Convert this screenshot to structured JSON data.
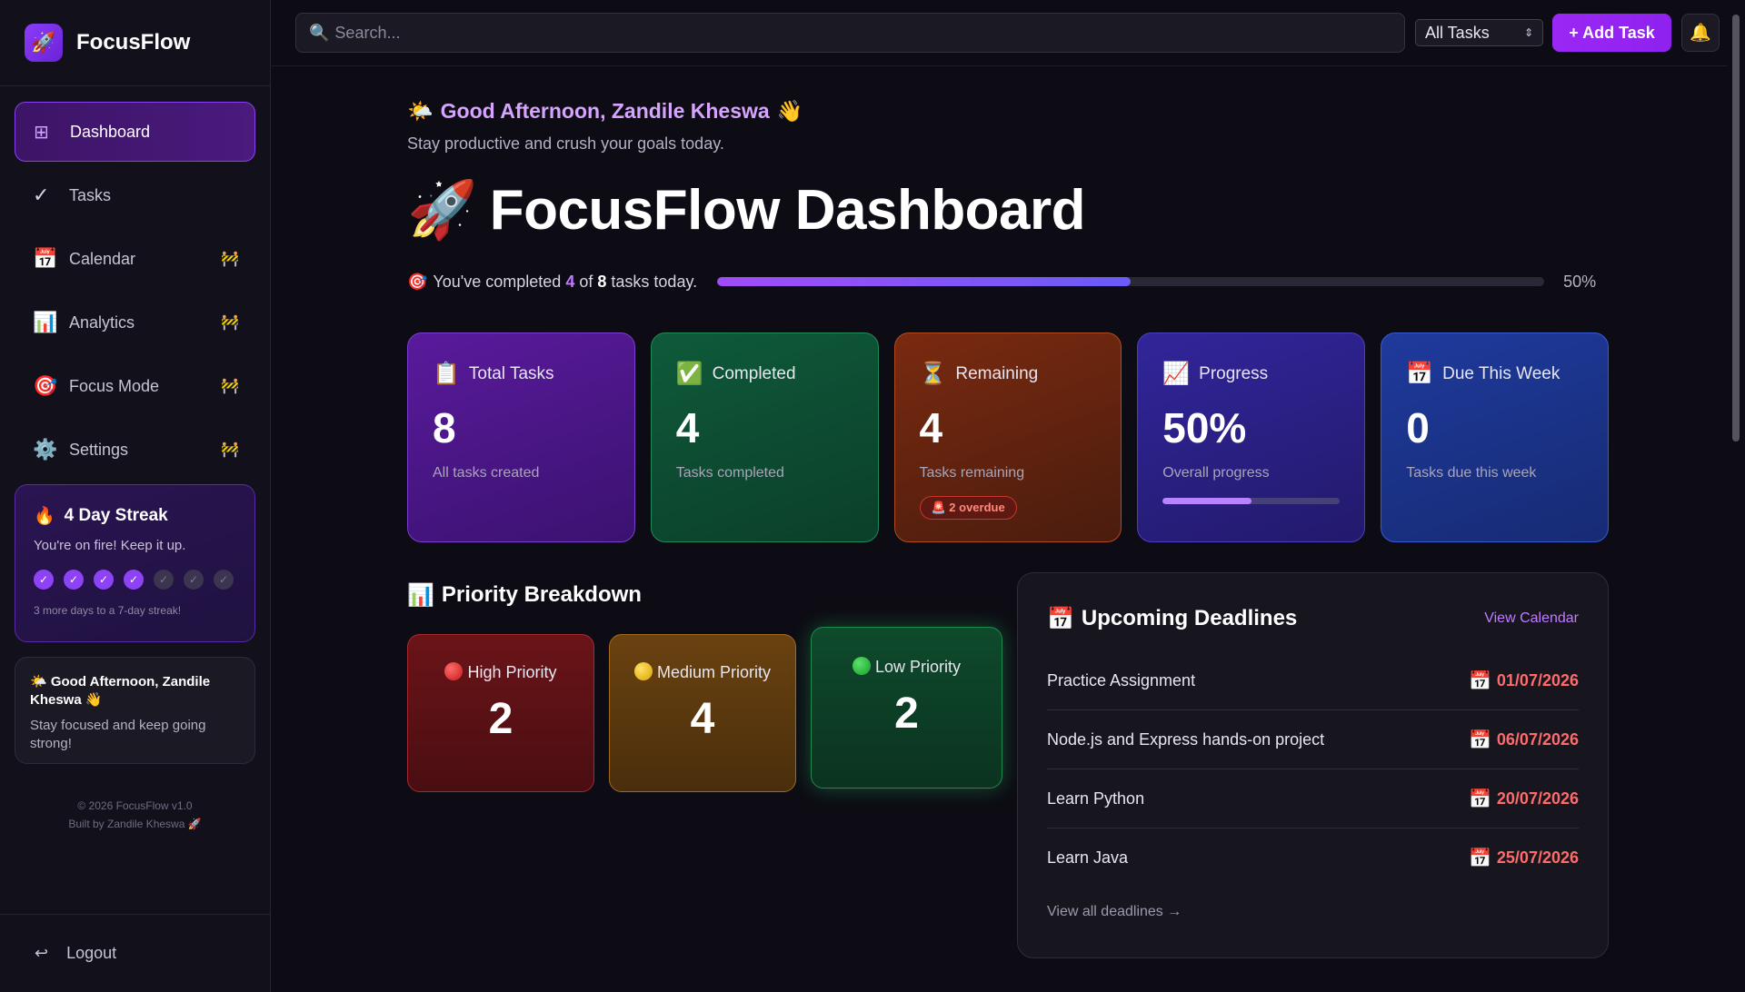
{
  "brand": {
    "name": "FocusFlow",
    "logo": "🚀"
  },
  "sidebar": {
    "items": [
      {
        "label": "Dashboard",
        "icon": "⊞",
        "locked": false
      },
      {
        "label": "Tasks",
        "icon": "✓",
        "locked": false
      },
      {
        "label": "Calendar",
        "icon": "📅",
        "locked": true
      },
      {
        "label": "Analytics",
        "icon": "📊",
        "locked": true
      },
      {
        "label": "Focus Mode",
        "icon": "🎯",
        "locked": true
      },
      {
        "label": "Settings",
        "icon": "⚙️",
        "locked": true
      }
    ],
    "lock_icon": "🚧",
    "streak": {
      "icon": "🔥",
      "title": "4 Day Streak",
      "subtitle": "You're on fire! Keep it up.",
      "days_completed": 4,
      "days_total": 7,
      "check": "✓",
      "note": "3 more days to a 7-day streak!"
    },
    "greeting": {
      "title": "🌤️ Good Afternoon, Zandile Kheswa 👋",
      "subtitle": "Stay focused and keep going strong!"
    },
    "footer_line1": "© 2026 FocusFlow v1.0",
    "footer_line2": "Built by Zandile Kheswa 🚀",
    "logout": {
      "label": "Logout",
      "icon": "↩"
    }
  },
  "topbar": {
    "search_placeholder": "Search...",
    "search_icon": "🔍",
    "filter_value": "All Tasks",
    "add_label": "+ Add Task",
    "bell_icon": "🔔"
  },
  "main": {
    "greeting_icon": "🌤️",
    "greeting": "Good Afternoon, Zandile Kheswa",
    "wave": "👋",
    "subtitle": "Stay productive and crush your goals today.",
    "title_icon": "🚀",
    "title": "FocusFlow Dashboard",
    "progress": {
      "icon": "🎯",
      "prefix": "You've completed",
      "completed": "4",
      "of": "of",
      "total": "8",
      "suffix": "tasks today.",
      "percent_label": "50%",
      "fraction": 0.5
    }
  },
  "cards": [
    {
      "icon": "📋",
      "label": "Total Tasks",
      "value": "8",
      "sub": "All tasks created",
      "theme": "purple"
    },
    {
      "icon": "✅",
      "label": "Completed",
      "value": "4",
      "sub": "Tasks completed",
      "theme": "green"
    },
    {
      "icon": "⏳",
      "label": "Remaining",
      "value": "4",
      "sub": "Tasks remaining",
      "theme": "orange",
      "badge": "🚨 2 overdue"
    },
    {
      "icon": "📈",
      "label": "Progress",
      "value": "50%",
      "sub": "Overall progress",
      "theme": "indigo",
      "fraction": 0.5
    },
    {
      "icon": "📅",
      "label": "Due This Week",
      "value": "0",
      "sub": "Tasks due this week",
      "theme": "blue"
    }
  ],
  "priority": {
    "icon": "📊",
    "title": "Priority Breakdown",
    "items": [
      {
        "label": "High Priority",
        "value": "2",
        "dot": "red"
      },
      {
        "label": "Medium Priority",
        "value": "4",
        "dot": "yellow"
      },
      {
        "label": "Low Priority",
        "value": "2",
        "dot": "green"
      }
    ]
  },
  "deadlines": {
    "icon": "📅",
    "title": "Upcoming Deadlines",
    "view_calendar": "View Calendar",
    "items": [
      {
        "name": "Practice Assignment",
        "date": "01/07/2026"
      },
      {
        "name": "Node.js and Express hands-on project",
        "date": "06/07/2026"
      },
      {
        "name": "Learn Python",
        "date": "20/07/2026"
      },
      {
        "name": "Learn Java",
        "date": "25/07/2026"
      }
    ],
    "view_all": "View all deadlines →"
  },
  "colors": {
    "accent": "#9a28f5",
    "danger": "#ff6b6b",
    "background": "#0d0c14"
  }
}
